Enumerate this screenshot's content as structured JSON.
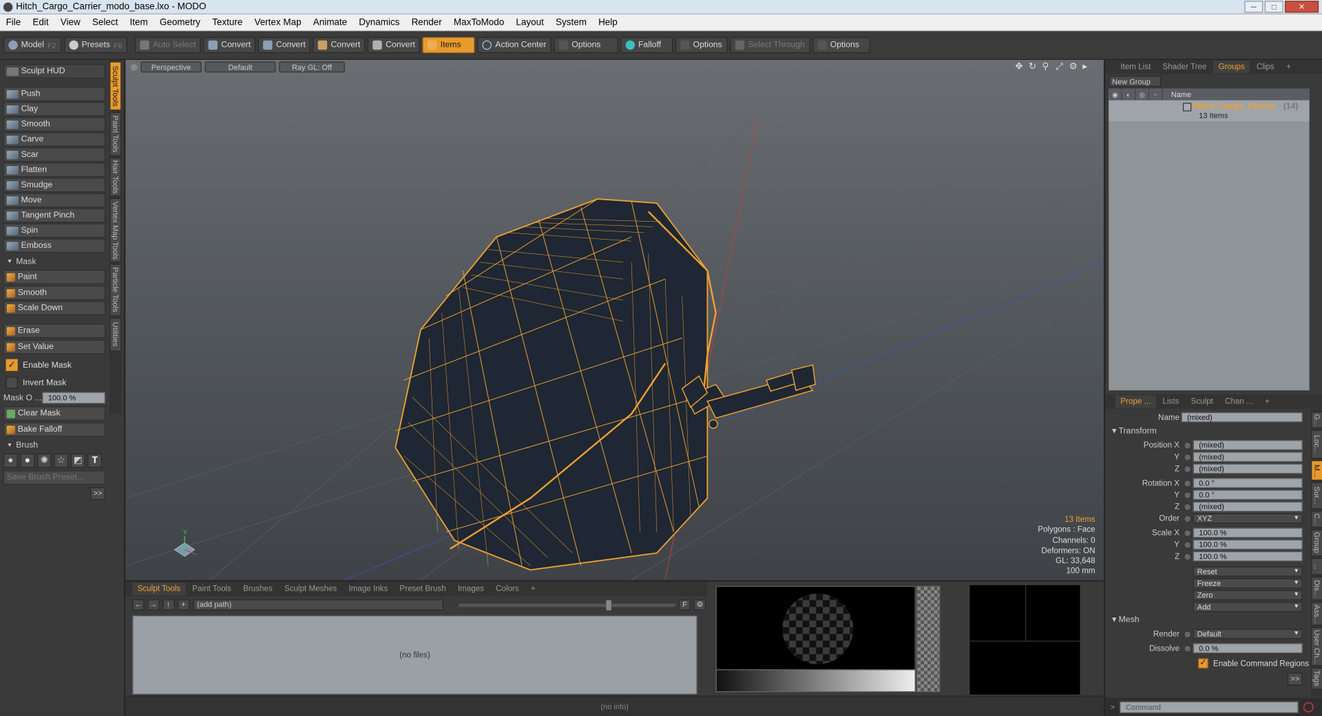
{
  "window": {
    "title": "Hitch_Cargo_Carrier_modo_base.lxo - MODO"
  },
  "menu": [
    "File",
    "Edit",
    "View",
    "Select",
    "Item",
    "Geometry",
    "Texture",
    "Vertex Map",
    "Animate",
    "Dynamics",
    "Render",
    "MaxToModo",
    "Layout",
    "System",
    "Help"
  ],
  "toolbar": {
    "model": "Model",
    "model_key": "F2",
    "presets": "Presets",
    "presets_key": "F6",
    "auto_select": "Auto Select",
    "convert1": "Convert",
    "convert2": "Convert",
    "convert3": "Convert",
    "convert4": "Convert",
    "items": "Items",
    "action_center": "Action Center",
    "options1": "Options",
    "falloff": "Falloff",
    "options2": "Options",
    "select_through": "Select Through",
    "options3": "Options"
  },
  "left": {
    "hud": "Sculpt HUD",
    "tools": [
      "Push",
      "Clay",
      "Smooth",
      "Carve",
      "Scar",
      "Flatten",
      "Smudge",
      "Move",
      "Tangent Pinch",
      "Spin",
      "Emboss"
    ],
    "mask_header": "Mask",
    "mask_tools": [
      "Paint",
      "Smooth",
      "Scale Down"
    ],
    "erase": "Erase",
    "set_value": "Set Value",
    "enable_mask": "Enable Mask",
    "invert_mask": "Invert Mask",
    "mask_opacity_label": "Mask O ...",
    "mask_opacity_value": "100.0 %",
    "clear_mask": "Clear Mask",
    "bake_falloff": "Bake Falloff",
    "brush_header": "Brush",
    "save_brush": "Save Brush Preset...",
    "more": ">>",
    "vtabs": [
      "Sculpt Tools",
      "Paint Tools",
      "Hair Tools",
      "Vertex Map Tools",
      "Particle Tools",
      "Utilities"
    ]
  },
  "viewport": {
    "tabs": [
      "Perspective",
      "Default",
      "Ray GL: Off"
    ],
    "stats": {
      "items": "13 Items",
      "polygons": "Polygons : Face",
      "channels": "Channels: 0",
      "deformers": "Deformers: ON",
      "gl": "GL: 33,648",
      "scale": "100 mm"
    }
  },
  "bottom": {
    "tabs": [
      "Sculpt Tools",
      "Paint Tools",
      "Brushes",
      "Sculpt Meshes",
      "Image Inks",
      "Preset Brush",
      "Images",
      "Colors",
      "+"
    ],
    "path": "(add path)",
    "nofiles": "(no files)",
    "status": "(no info)"
  },
  "right": {
    "tabs": [
      "Item List",
      "Shader Tree",
      "Groups",
      "Clips",
      "+"
    ],
    "new_group": "New Group",
    "col_name": "Name",
    "group": {
      "name": "Hitch_Cargo_Carrier",
      "count": "(14)",
      "sub": "13 Items"
    },
    "prop_tabs": [
      "Prope ...",
      "Lists",
      "Sculpt",
      "Chan ...",
      "+"
    ],
    "name_label": "Name",
    "name_value": "(mixed)",
    "transform": "Transform",
    "position": [
      {
        "axis": "Position X",
        "value": "(mixed)"
      },
      {
        "axis": "Y",
        "value": "(mixed)"
      },
      {
        "axis": "Z",
        "value": "(mixed)"
      }
    ],
    "rotation": [
      {
        "axis": "Rotation X",
        "value": "0.0 °"
      },
      {
        "axis": "Y",
        "value": "0.0 °"
      },
      {
        "axis": "Z",
        "value": "(mixed)"
      }
    ],
    "order_label": "Order",
    "order_value": "XYZ",
    "scale": [
      {
        "axis": "Scale X",
        "value": "100.0 %"
      },
      {
        "axis": "Y",
        "value": "100.0 %"
      },
      {
        "axis": "Z",
        "value": "100.0 %"
      }
    ],
    "actions": [
      "Reset",
      "Freeze",
      "Zero",
      "Add"
    ],
    "mesh": "Mesh",
    "render_label": "Render",
    "render_value": "Default",
    "dissolve_label": "Dissolve",
    "dissolve_value": "0.0 %",
    "enable_cmd": "Enable Command Regions",
    "more": ">>",
    "command_placeholder": "Command",
    "vtabs": [
      "G...",
      "Loc...",
      "M...",
      "Sur...",
      "C...",
      "Group",
      "...",
      "Dis...",
      "Ass...",
      "User Ch...",
      "Tags"
    ]
  }
}
